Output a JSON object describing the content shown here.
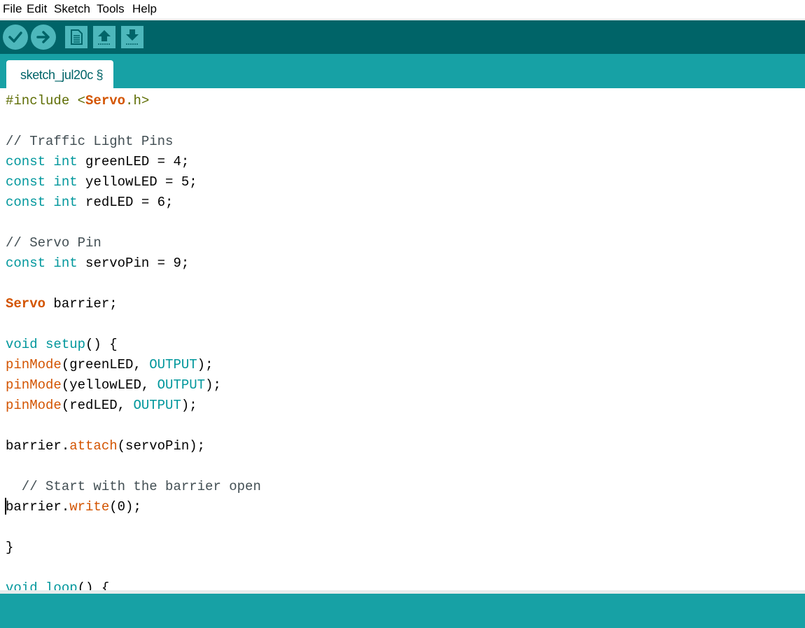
{
  "menu": {
    "items": [
      "File",
      "Edit",
      "Sketch",
      "Tools",
      "Help"
    ]
  },
  "toolbar": {
    "buttons": [
      {
        "icon": "verify-checkmark-icon"
      },
      {
        "icon": "upload-arrow-right-icon"
      },
      {
        "icon": "new-sketch-icon"
      },
      {
        "icon": "open-up-arrow-icon"
      },
      {
        "icon": "save-down-arrow-icon"
      }
    ]
  },
  "tabs": [
    {
      "label": "sketch_jul20c §"
    }
  ],
  "code": {
    "lines": [
      {
        "segments": [
          {
            "t": "#include ",
            "c": "pre"
          },
          {
            "t": "<",
            "c": "pre"
          },
          {
            "t": "Servo",
            "c": "class"
          },
          {
            "t": ".h>",
            "c": "pre"
          }
        ]
      },
      {
        "segments": []
      },
      {
        "segments": [
          {
            "t": "// Traffic Light Pins",
            "c": "comment"
          }
        ]
      },
      {
        "segments": [
          {
            "t": "const",
            "c": "type"
          },
          {
            "t": " ",
            "c": ""
          },
          {
            "t": "int",
            "c": "type"
          },
          {
            "t": " greenLED = 4;",
            "c": ""
          }
        ]
      },
      {
        "segments": [
          {
            "t": "const",
            "c": "type"
          },
          {
            "t": " ",
            "c": ""
          },
          {
            "t": "int",
            "c": "type"
          },
          {
            "t": " yellowLED = 5;",
            "c": ""
          }
        ]
      },
      {
        "segments": [
          {
            "t": "const",
            "c": "type"
          },
          {
            "t": " ",
            "c": ""
          },
          {
            "t": "int",
            "c": "type"
          },
          {
            "t": " redLED = 6;",
            "c": ""
          }
        ]
      },
      {
        "segments": []
      },
      {
        "segments": [
          {
            "t": "// Servo Pin",
            "c": "comment"
          }
        ]
      },
      {
        "segments": [
          {
            "t": "const",
            "c": "type"
          },
          {
            "t": " ",
            "c": ""
          },
          {
            "t": "int",
            "c": "type"
          },
          {
            "t": " servoPin = 9;",
            "c": ""
          }
        ]
      },
      {
        "segments": []
      },
      {
        "segments": [
          {
            "t": "Servo",
            "c": "class"
          },
          {
            "t": " barrier;",
            "c": ""
          }
        ]
      },
      {
        "segments": []
      },
      {
        "segments": [
          {
            "t": "void",
            "c": "type"
          },
          {
            "t": " ",
            "c": ""
          },
          {
            "t": "setup",
            "c": "type"
          },
          {
            "t": "() {",
            "c": ""
          }
        ]
      },
      {
        "segments": [
          {
            "t": "pinMode",
            "c": "func"
          },
          {
            "t": "(greenLED, ",
            "c": ""
          },
          {
            "t": "OUTPUT",
            "c": "type"
          },
          {
            "t": ");",
            "c": ""
          }
        ]
      },
      {
        "segments": [
          {
            "t": "pinMode",
            "c": "func"
          },
          {
            "t": "(yellowLED, ",
            "c": ""
          },
          {
            "t": "OUTPUT",
            "c": "type"
          },
          {
            "t": ");",
            "c": ""
          }
        ]
      },
      {
        "segments": [
          {
            "t": "pinMode",
            "c": "func"
          },
          {
            "t": "(redLED, ",
            "c": ""
          },
          {
            "t": "OUTPUT",
            "c": "type"
          },
          {
            "t": ");",
            "c": ""
          }
        ]
      },
      {
        "segments": []
      },
      {
        "segments": [
          {
            "t": "barrier.",
            "c": ""
          },
          {
            "t": "attach",
            "c": "func"
          },
          {
            "t": "(servoPin);",
            "c": ""
          }
        ]
      },
      {
        "segments": []
      },
      {
        "segments": [
          {
            "t": "  // Start with the barrier open",
            "c": "comment"
          }
        ]
      },
      {
        "segments": [
          {
            "t": "barrier.",
            "c": ""
          },
          {
            "t": "write",
            "c": "func"
          },
          {
            "t": "(0);",
            "c": ""
          }
        ]
      },
      {
        "segments": []
      },
      {
        "segments": [
          {
            "t": "}",
            "c": ""
          }
        ]
      },
      {
        "segments": []
      },
      {
        "segments": [
          {
            "t": "void",
            "c": "type"
          },
          {
            "t": " ",
            "c": ""
          },
          {
            "t": "loop",
            "c": "type"
          },
          {
            "t": "() {",
            "c": ""
          }
        ]
      }
    ]
  },
  "colors": {
    "toolbar_bg": "#006468",
    "tabbar_bg": "#17a1a5",
    "button_bg": "#4db7bb",
    "keyword": "#00979c",
    "function": "#d35400",
    "comment": "#434f54",
    "preprocessor": "#5e6d03"
  }
}
